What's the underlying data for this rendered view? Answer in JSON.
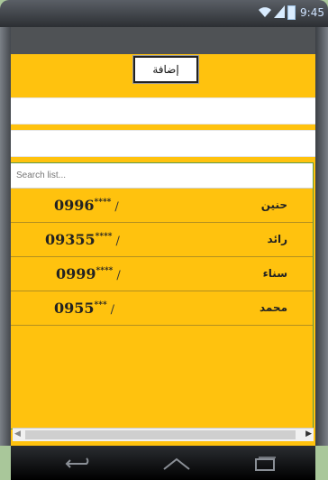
{
  "status_bar": {
    "time": "9:45"
  },
  "form": {
    "add_button_label": "إضافة",
    "field1_value": "",
    "field2_value": ""
  },
  "list": {
    "search_placeholder": "Search list...",
    "rows": [
      {
        "name": "حنين",
        "phone": "0996",
        "mask": "****",
        "sep": "/"
      },
      {
        "name": "رائد",
        "phone": "09355",
        "mask": "****",
        "sep": "/"
      },
      {
        "name": "سناء",
        "phone": "0999",
        "mask": "****",
        "sep": "/"
      },
      {
        "name": "محمد",
        "phone": "0955",
        "mask": "***",
        "sep": "/"
      }
    ]
  },
  "icons": {
    "wifi": "wifi-icon",
    "signal": "signal-icon",
    "battery": "battery-icon",
    "back": "back-icon",
    "home": "home-icon",
    "recent": "recent-apps-icon"
  },
  "colors": {
    "background": "#ffc20e",
    "titlebar": "#4f5255"
  }
}
